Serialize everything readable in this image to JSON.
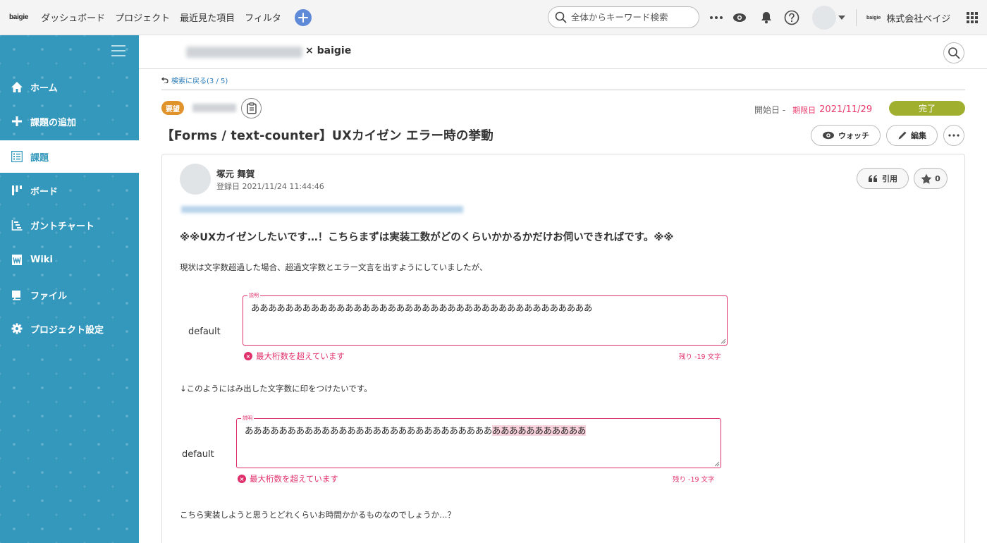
{
  "topbar": {
    "logo": "baigie",
    "nav": [
      "ダッシュボード",
      "プロジェクト",
      "最近見た項目",
      "フィルタ"
    ],
    "search_placeholder": "全体からキーワード検索",
    "org_logo": "baigie",
    "org_name": "株式会社ベイジ"
  },
  "sidebar": {
    "items": [
      {
        "label": "ホーム",
        "icon": "home-icon"
      },
      {
        "label": "課題の追加",
        "icon": "plus-icon"
      },
      {
        "label": "課題",
        "icon": "list-icon",
        "active": true
      },
      {
        "label": "ボード",
        "icon": "board-icon"
      },
      {
        "label": "ガントチャート",
        "icon": "gantt-icon"
      },
      {
        "label": "Wiki",
        "icon": "wiki-icon"
      },
      {
        "label": "ファイル",
        "icon": "file-icon"
      },
      {
        "label": "プロジェクト設定",
        "icon": "gear-icon"
      }
    ]
  },
  "project": {
    "name_suffix": "× baigie"
  },
  "issue": {
    "back_link": "検索に戻る(3 / 5)",
    "type_badge": "要望",
    "start_label": "開始日 -",
    "due_label": "期限日",
    "due_date": "2021/11/29",
    "status": "完了",
    "title": "【Forms / text-counter】UXカイゼン エラー時の挙動",
    "watch_label": "ウォッチ",
    "edit_label": "編集"
  },
  "description": {
    "author_name": "塚元 舞賀",
    "registered": "登録日 2021/11/24 11:44:46",
    "cite_label": "引用",
    "star_count": "0",
    "lead": "※※UXカイゼンしたいです…！こちらまずは実装工数がどのくらいかかるかだけお伺いできればです。※※",
    "para1": "現状は文字数超過した場合、超過文字数とエラー文言を出すようにしていましたが、",
    "para2": "↓このようにはみ出した文字数に印をつけたいです。",
    "para3": "こちら実装しようと思うとどれくらいお時間かかるものなのでしょうか…？",
    "demo1": {
      "label": "default",
      "legend": "説明",
      "text": "ああああああああああああああああああああああああああああああああああああああああ",
      "error": "最大桁数を超えています",
      "count": "残り -19 文字"
    },
    "demo2": {
      "label": "default",
      "legend": "説明",
      "text_ok": "あああああああああああああああああああああああああああああ",
      "text_over": "あああああああああああ",
      "error": "最大桁数を超えています",
      "count": "残り -19 文字"
    }
  },
  "colors": {
    "sidebar": "#3498bd",
    "accent_blue": "#2b7bb9",
    "due_red": "#e8396b",
    "status_green": "#a1af2f",
    "type_orange": "#e1932b",
    "error_pink": "#e0306c"
  }
}
